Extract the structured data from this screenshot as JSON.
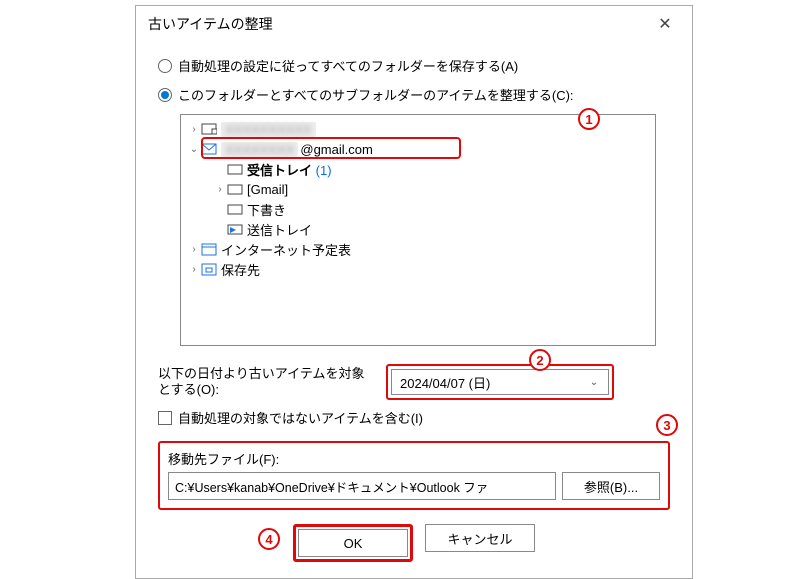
{
  "dialog": {
    "title": "古いアイテムの整理",
    "close": "✕"
  },
  "radios": {
    "opt_a": "自動処理の設定に従ってすべてのフォルダーを保存する(A)",
    "opt_c": "このフォルダーとすべてのサブフォルダーのアイテムを整理する(C):"
  },
  "tree": {
    "account1_masked": "XXXXXXXXXX",
    "account2_masked": "XXXXXXXX",
    "account2_suffix": "@gmail.com",
    "inbox": "受信トレイ",
    "inbox_count": "(1)",
    "gmail": "[Gmail]",
    "drafts": "下書き",
    "sent": "送信トレイ",
    "internet_cal": "インターネット予定表",
    "archive": "保存先"
  },
  "date": {
    "label": "以下の日付より古いアイテムを対象とする(O):",
    "value": "2024/04/07 (日)"
  },
  "include": {
    "label": "自動処理の対象ではないアイテムを含む(I)"
  },
  "file": {
    "label": "移動先ファイル(F):",
    "path": "C:¥Users¥kanab¥OneDrive¥ドキュメント¥Outlook ファ",
    "browse": "参照(B)..."
  },
  "buttons": {
    "ok": "OK",
    "cancel": "キャンセル"
  },
  "annot": {
    "n1": "1",
    "n2": "2",
    "n3": "3",
    "n4": "4"
  }
}
